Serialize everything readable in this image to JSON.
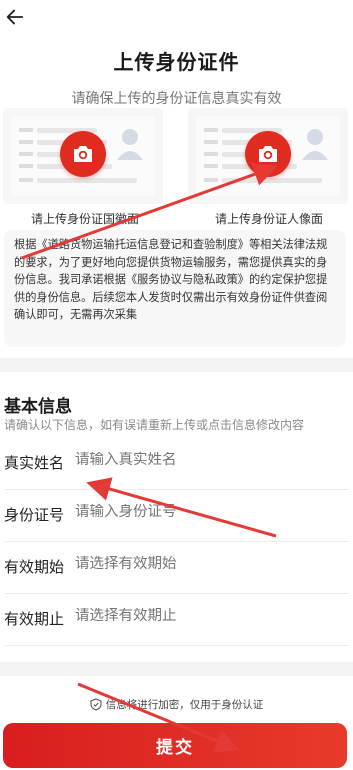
{
  "header": {
    "back_icon": "back-arrow-icon",
    "title": "上传身份证件",
    "subtitle": "请确保上传的身份证信息真实有效"
  },
  "upload": {
    "front_label": "请上传身份证国徽面",
    "back_label": "请上传身份证人像面",
    "camera_icon": "camera-icon",
    "accent_color": "#e02b20"
  },
  "notice": {
    "text": "根据《道路货物运输托运信息登记和查验制度》等相关法律法规的要求，为了更好地向您提供货物运输服务，需您提供真实的身份信息。我司承诺根据《服务协议与隐私政策》的约定保护您提供的身份信息。后续您本人发货时仅需出示有效身份证件供查阅确认即可，无需再次采集"
  },
  "basic_info": {
    "title": "基本信息",
    "hint": "请确认以下信息，如有误请重新上传或点击信息修改内容",
    "fields": [
      {
        "label": "真实姓名",
        "placeholder": "请输入真实姓名"
      },
      {
        "label": "身份证号",
        "placeholder": "请输入身份证号"
      },
      {
        "label": "有效期始",
        "placeholder": "请选择有效期始"
      },
      {
        "label": "有效期止",
        "placeholder": "请选择有效期止"
      }
    ]
  },
  "footer": {
    "secure_text": "信息将进行加密，仅用于身份认证",
    "shield_icon": "shield-icon",
    "submit_label": "提交",
    "button_color": "#e02b20"
  }
}
